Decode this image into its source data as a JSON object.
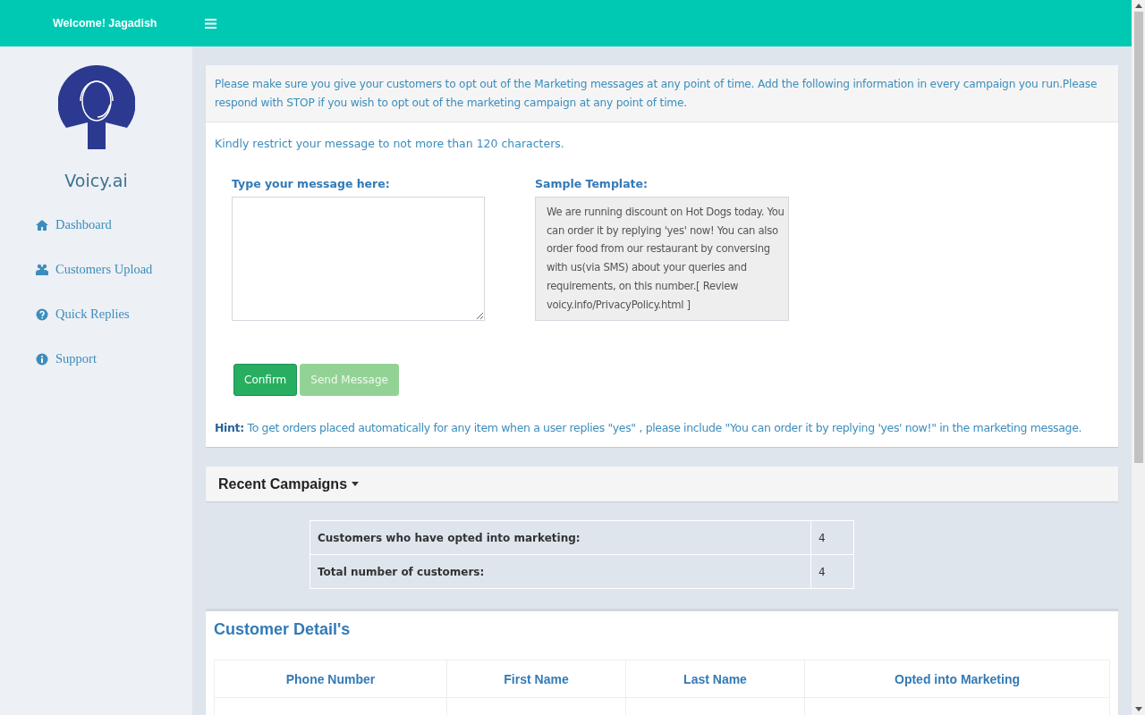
{
  "top_bar": {
    "welcome": "Welcome! Jagadish"
  },
  "sidebar": {
    "brand": "Voicy.ai",
    "items": [
      {
        "label": "Dashboard",
        "kind": "home"
      },
      {
        "label": "Customers Upload",
        "kind": "users"
      },
      {
        "label": "Quick Replies",
        "kind": "question"
      },
      {
        "label": "Support",
        "kind": "info"
      }
    ]
  },
  "compose": {
    "notice": "Please make sure you give your customers to opt out of the Marketing messages at any point of time. Add the following information in every campaign you run.Please respond with STOP if you wish to opt out of the marketing campaign at any point of time.",
    "limit": "Kindly restrict your message to not more than 120 characters.",
    "message_label": "Type your message here:",
    "template_label": "Sample Template:",
    "template": "We are running discount on Hot Dogs today. You can order it by replying 'yes' now! You can also order food from our restaurant by conversing with us(via SMS) about your queries and requirements, on this number.[ Review voicy.info/PrivacyPolicy.html ]",
    "buttons": [
      {
        "label": "Confirm",
        "disabled": false
      },
      {
        "label": "Send Message",
        "disabled": true
      }
    ],
    "hint": "**Hint:** To get orders placed automatically for any item when a user replies \"yes\" , please include \"You can order it by replying 'yes' now!\" in the marketing message."
  },
  "recent_campaigns": {
    "title": "Recent Campaigns",
    "expanded": true,
    "stats": [
      {
        "label": "Customers who have opted into marketing:",
        "value": "4"
      },
      {
        "label": "Total number of customers:",
        "value": "4"
      }
    ]
  },
  "customer_details": {
    "title": "Customer Detail's",
    "columns": [
      "Phone Number",
      "First Name",
      "Last Name",
      "Opted into Marketing"
    ]
  }
}
